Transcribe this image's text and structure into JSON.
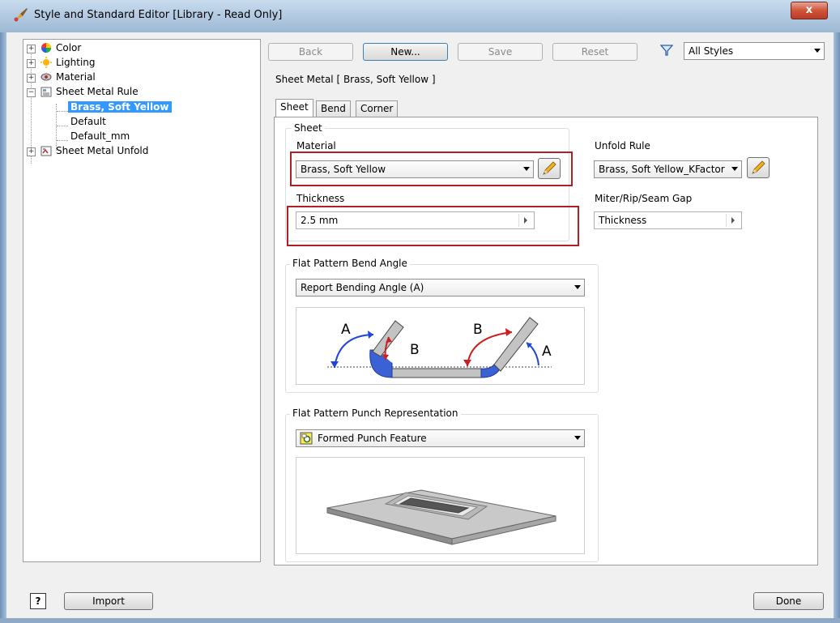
{
  "window": {
    "title": "Style and Standard Editor [Library - Read Only]",
    "close_glyph": "x"
  },
  "tree": {
    "items": [
      {
        "label": "Color",
        "icon": "color-wheel-icon"
      },
      {
        "label": "Lighting",
        "icon": "lighting-icon"
      },
      {
        "label": "Material",
        "icon": "material-icon"
      },
      {
        "label": "Sheet Metal Rule",
        "icon": "sheet-metal-rule-icon"
      },
      {
        "label": "Brass, Soft Yellow",
        "selected": true
      },
      {
        "label": "Default"
      },
      {
        "label": "Default_mm"
      },
      {
        "label": "Sheet Metal Unfold",
        "icon": "sheet-metal-unfold-icon"
      }
    ],
    "expander_plus": "+",
    "expander_minus": "−"
  },
  "toolbar": {
    "back": "Back",
    "new": "New...",
    "save": "Save",
    "reset": "Reset",
    "filter_value": "All Styles"
  },
  "panel": {
    "header": "Sheet Metal [ Brass, Soft Yellow ]",
    "tabs": [
      "Sheet",
      "Bend",
      "Corner"
    ],
    "active_tab": "Sheet"
  },
  "sheet": {
    "group_title": "Sheet",
    "material_label": "Material",
    "material_value": "Brass, Soft Yellow",
    "thickness_label": "Thickness",
    "thickness_value": "2.5 mm",
    "unfold_rule_label": "Unfold Rule",
    "unfold_rule_value": "Brass, Soft Yellow_KFactor",
    "gap_label": "Miter/Rip/Seam Gap",
    "gap_value": "Thickness"
  },
  "bend_angle": {
    "group_title": "Flat Pattern Bend Angle",
    "value": "Report Bending Angle (A)",
    "diagram_labels": {
      "a": "A",
      "b": "B"
    }
  },
  "punch": {
    "group_title": "Flat Pattern Punch Representation",
    "value": "Formed Punch Feature"
  },
  "footer": {
    "help": "?",
    "import": "Import",
    "done": "Done"
  },
  "colors": {
    "highlight": "#b21f24",
    "selection": "#3399ff",
    "angle_a": "#1e47d6",
    "angle_b": "#cc1f1f",
    "bend_fill": "#3b62d4"
  }
}
